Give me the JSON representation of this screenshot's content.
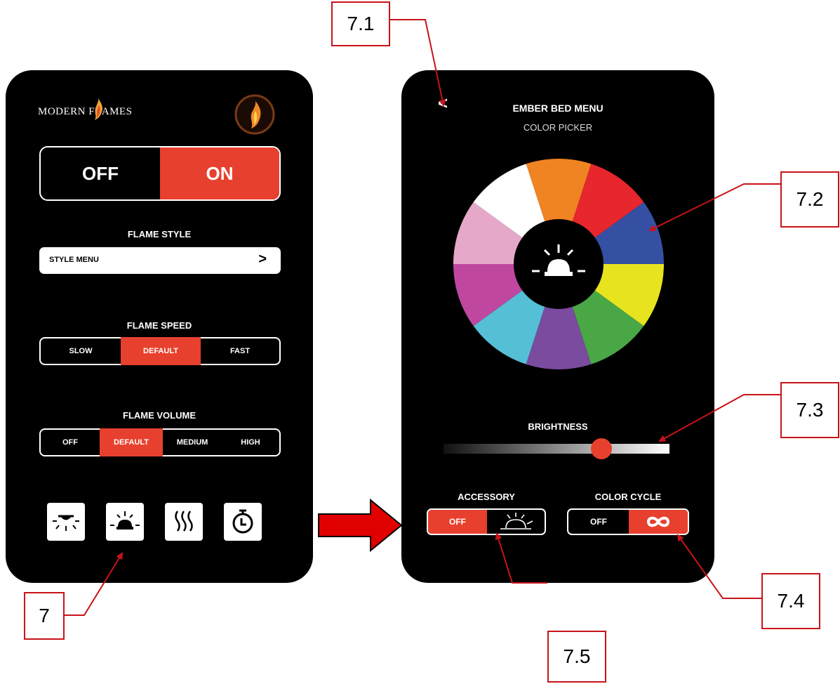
{
  "callouts": {
    "c7": "7",
    "c71": "7.1",
    "c72": "7.2",
    "c73": "7.3",
    "c74": "7.4",
    "c75": "7.5"
  },
  "left_screen": {
    "logo_text": "MODERN FLAMES",
    "power": {
      "off": "OFF",
      "on": "ON",
      "selected": "ON"
    },
    "flame_style": {
      "title": "FLAME STYLE",
      "button": "STYLE MENU",
      "chevron": ">"
    },
    "flame_speed": {
      "title": "FLAME SPEED",
      "options": [
        "SLOW",
        "DEFAULT",
        "FAST"
      ],
      "selected": "DEFAULT"
    },
    "flame_volume": {
      "title": "FLAME VOLUME",
      "options": [
        "OFF",
        "DEFAULT",
        "MEDIUM",
        "HIGH"
      ],
      "selected": "DEFAULT"
    },
    "bottom_icons": [
      "downlight-icon",
      "ember-bed-icon",
      "heat-icon",
      "timer-icon"
    ]
  },
  "right_screen": {
    "back": "<",
    "title": "EMBER BED MENU",
    "subtitle": "COLOR PICKER",
    "wheel_colors": [
      "#f08322",
      "#e8262d",
      "#3550a3",
      "#e7e41f",
      "#4aa745",
      "#7a4b9e",
      "#55bfd6",
      "#bf47a0",
      "#e6a8c8",
      "#ffffff"
    ],
    "brightness": {
      "label": "BRIGHTNESS",
      "value": 0.7
    },
    "accessory": {
      "label": "ACCESSORY",
      "off": "OFF",
      "selected": "OFF"
    },
    "color_cycle": {
      "label": "COLOR CYCLE",
      "off": "OFF",
      "selected": "infinity"
    }
  },
  "colors": {
    "accent": "#e8402e",
    "arrow": "#e00000",
    "callout_line": "#c8141a"
  }
}
